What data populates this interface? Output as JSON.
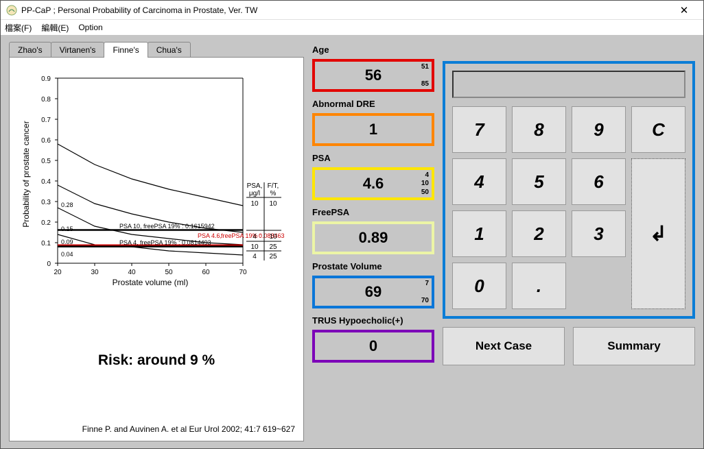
{
  "window": {
    "title": "PP-CaP ; Personal Probability of Carcinoma in Prostate, Ver. TW",
    "close": "✕"
  },
  "menu": {
    "file": "檔案(F)",
    "edit": "編輯(E)",
    "option": "Option"
  },
  "tabs": {
    "t0": "Zhao's",
    "t1": "Virtanen's",
    "t2": "Finne's",
    "t3": "Chua's"
  },
  "chart": {
    "ylabel": "Probability of prostate cancer",
    "xlabel": "Prostate volume (ml)",
    "legend_psa_h": "PSA,",
    "legend_psa_u": "μg/l",
    "legend_ft_h": "F/T,",
    "legend_ft_u": "%",
    "leg_r0_psa": "10",
    "leg_r0_ft": "10",
    "leg_r1_psa": "4",
    "leg_r1_ft": "10",
    "leg_r2_psa": "10",
    "leg_r2_ft": "25",
    "leg_r3_psa": "4",
    "leg_r3_ft": "25",
    "ann0": "0.28",
    "ann1": "0.15",
    "ann2": "0.09",
    "ann3": "0.04",
    "line1": "PSA 10, freePSA 19% : 0.1615942",
    "line2": "PSA 4, freePSA 19% : 0.0814493",
    "line3_a": "PSA 4.6,",
    "line3_b": "freePSA 19% :",
    "line3_c": "0.088463",
    "yt0": "0",
    "yt1": "0.1",
    "yt2": "0.2",
    "yt3": "0.3",
    "yt4": "0.4",
    "yt5": "0.5",
    "yt6": "0.6",
    "yt7": "0.7",
    "yt8": "0.8",
    "yt9": "0.9",
    "xt20": "20",
    "xt30": "30",
    "xt40": "40",
    "xt50": "50",
    "xt60": "60",
    "xt70": "70"
  },
  "risk_text": "Risk:  around  9 %",
  "citation": "Finne P. and Auvinen A. et al    Eur Urol  2002; 41:7 619~627",
  "fields": {
    "age": {
      "label": "Age",
      "value": "56",
      "min": "51",
      "max": "85",
      "color": "#e20400"
    },
    "dre": {
      "label": "Abnormal DRE",
      "value": "1",
      "color": "#ff8500"
    },
    "psa": {
      "label": "PSA",
      "value": "4.6",
      "min": "4",
      "mid": "10",
      "max": "50",
      "color": "#ffe600"
    },
    "freepsa": {
      "label": "FreePSA",
      "value": "0.89",
      "color": "#ecf5a6"
    },
    "pvol": {
      "label": "Prostate Volume",
      "value": "69",
      "min": "7",
      "max": "70",
      "color": "#0a76d8"
    },
    "trus": {
      "label": "TRUS Hypoecholic(+)",
      "value": "0",
      "color": "#7c00b8"
    }
  },
  "calc": {
    "k7": "7",
    "k8": "8",
    "k9": "9",
    "kc": "C",
    "k4": "4",
    "k5": "5",
    "k6": "6",
    "k1": "1",
    "k2": "2",
    "k3": "3",
    "k0": "0",
    "kd": ".",
    "ke": "↲"
  },
  "actions": {
    "next": "Next Case",
    "summary": "Summary"
  },
  "chart_data": {
    "type": "line",
    "xlabel": "Prostate volume (ml)",
    "ylabel": "Probability of prostate cancer",
    "xlim": [
      20,
      70
    ],
    "ylim": [
      0,
      0.9
    ],
    "x": [
      20,
      30,
      40,
      50,
      60,
      70
    ],
    "series": [
      {
        "name": "PSA 10 μg/l, F/T 10%",
        "values": [
          0.58,
          0.48,
          0.41,
          0.36,
          0.32,
          0.28
        ]
      },
      {
        "name": "PSA 4 μg/l, F/T 10%",
        "values": [
          0.38,
          0.29,
          0.24,
          0.2,
          0.17,
          0.15
        ]
      },
      {
        "name": "PSA 10 μg/l, F/T 25%",
        "values": [
          0.27,
          0.18,
          0.14,
          0.12,
          0.1,
          0.09
        ]
      },
      {
        "name": "PSA 4 μg/l, F/T 25%",
        "values": [
          0.14,
          0.09,
          0.08,
          0.06,
          0.05,
          0.04
        ]
      }
    ],
    "reference_lines": [
      {
        "name": "PSA 10, freePSA 19%",
        "y": 0.1616
      },
      {
        "name": "PSA 4.6, freePSA 19%",
        "y": 0.0885
      },
      {
        "name": "PSA 4, freePSA 19%",
        "y": 0.0814
      }
    ],
    "risk_result_percent": 9
  }
}
